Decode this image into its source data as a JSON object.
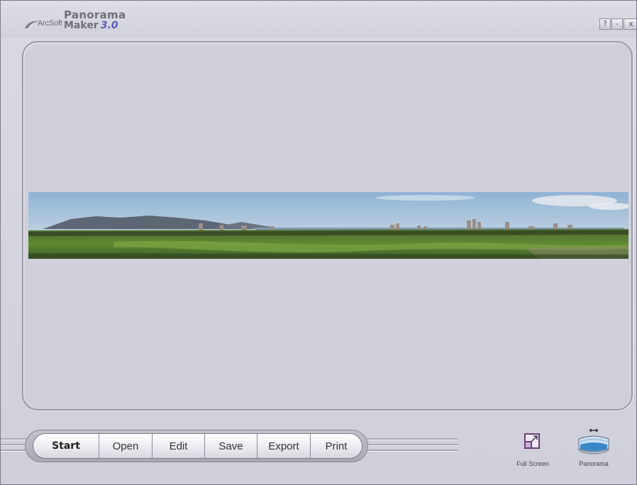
{
  "app": {
    "brand": "ArcSoft",
    "title_line1": "Panorama",
    "title_line2": "Maker",
    "version": "3.0"
  },
  "window_controls": {
    "help": "?",
    "minimize": "-",
    "close": "x"
  },
  "toolbar": {
    "buttons": [
      {
        "label": "Start",
        "active": true
      },
      {
        "label": "Open",
        "active": false
      },
      {
        "label": "Edit",
        "active": false
      },
      {
        "label": "Save",
        "active": false
      },
      {
        "label": "Export",
        "active": false
      },
      {
        "label": "Print",
        "active": false
      }
    ]
  },
  "tools": {
    "fullscreen_label": "Full Screen",
    "panorama_label": "Panorama"
  },
  "colors": {
    "window_bg": "#d3d3dc",
    "viewer_bg": "#d0d0db",
    "version_accent": "#5a5ac4"
  },
  "icons": {
    "logo": "arcsoft-swoosh-icon",
    "fullscreen": "fullscreen-icon",
    "panorama": "panorama-icon"
  }
}
